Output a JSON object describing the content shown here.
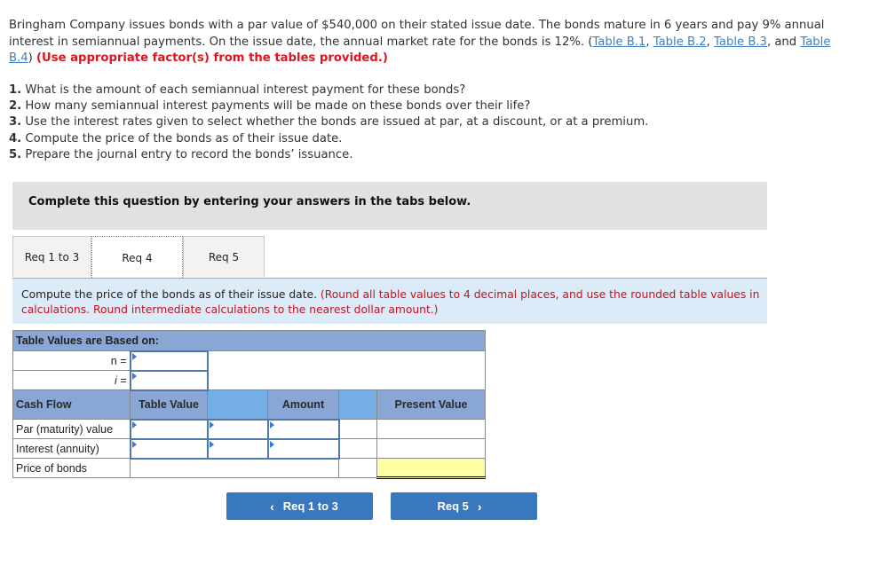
{
  "intro": {
    "text1": "Bringham Company issues bonds with a par value of $540,000 on their stated issue date. The bonds mature in 6 years and pay 9% annual interest in semiannual payments. On the issue date, the annual market rate for the bonds is 12%. (",
    "links": [
      "Table B.1",
      "Table B.2",
      "Table B.3",
      "Table B.4"
    ],
    "sep1": ", ",
    "sep2": ", ",
    "sep3": ", and ",
    "close": ") ",
    "instruction": "(Use appropriate factor(s) from the tables provided.)"
  },
  "requirements": [
    {
      "num": "1.",
      "text": " What is the amount of each semiannual interest payment for these bonds?"
    },
    {
      "num": "2.",
      "text": " How many semiannual interest payments will be made on these bonds over their life?"
    },
    {
      "num": "3.",
      "text": " Use the interest rates given to select whether the bonds are issued at par, at a discount, or at a premium."
    },
    {
      "num": "4.",
      "text": " Compute the price of the bonds as of their issue date."
    },
    {
      "num": "5.",
      "text": " Prepare the journal entry to record the bonds’ issuance."
    }
  ],
  "banner": "Complete this question by entering your answers in the tabs below.",
  "tabs": [
    {
      "label": "Req 1 to 3",
      "active": false
    },
    {
      "label": "Req 4",
      "active": true
    },
    {
      "label": "Req 5",
      "active": false
    }
  ],
  "instructions": {
    "main": "Compute the price of the bonds as of their issue date. ",
    "note": "(Round all table values to 4 decimal places, and use the rounded table values in calculations. Round intermediate calculations to the nearest dollar amount.)"
  },
  "table": {
    "caption": "Table Values are Based on:",
    "n_label": "n =",
    "i_label": "i =",
    "n_value": "",
    "i_value": "",
    "headers": {
      "cash_flow": "Cash Flow",
      "table_value": "Table Value",
      "amount": "Amount",
      "present_value": "Present Value"
    },
    "rows": [
      {
        "label": "Par (maturity) value",
        "table_value": "",
        "operator": "",
        "amount": "",
        "present_value": ""
      },
      {
        "label": "Interest (annuity)",
        "table_value": "",
        "operator": "",
        "amount": "",
        "present_value": ""
      }
    ],
    "total_label": "Price of bonds",
    "total_value": ""
  },
  "nav": {
    "prev_label": "Req 1 to 3",
    "next_label": "Req 5",
    "prev_icon": "‹",
    "next_icon": "›"
  }
}
